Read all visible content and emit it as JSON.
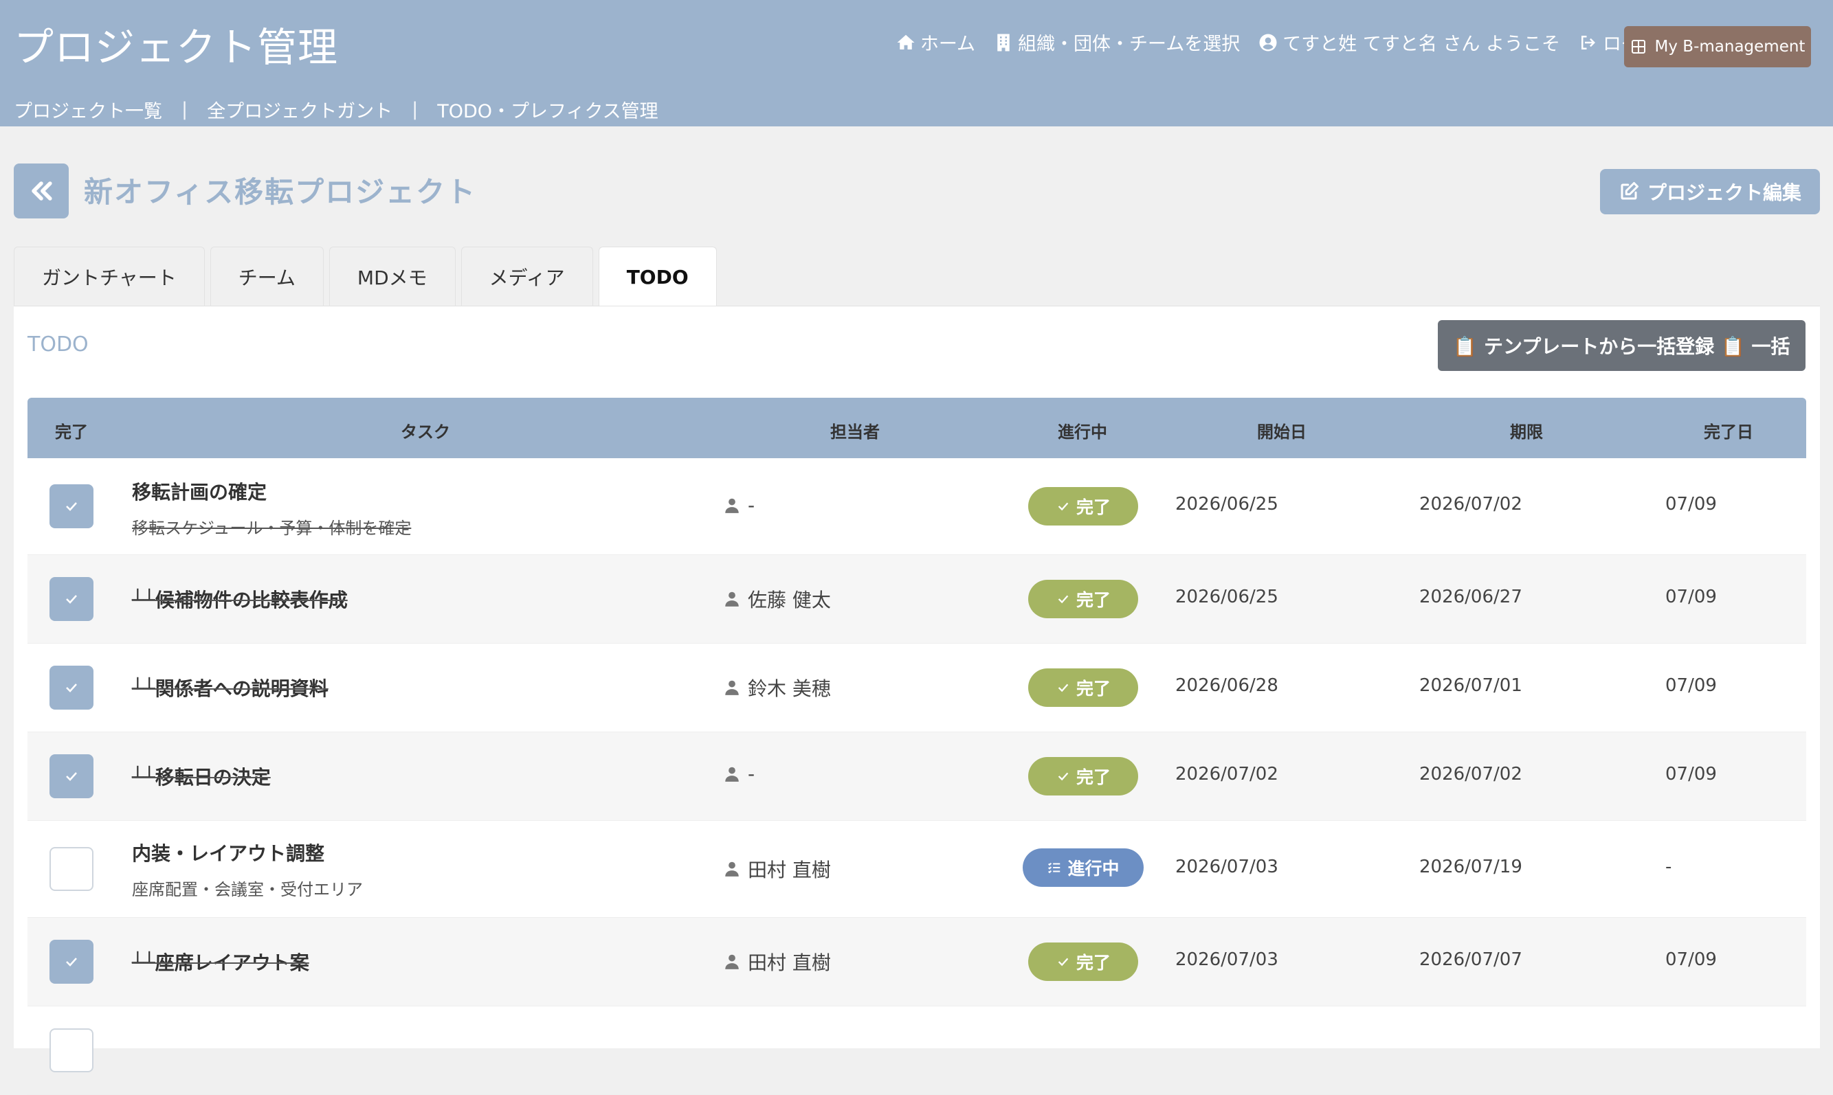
{
  "app_title": "プロジェクト管理",
  "topnav": {
    "home": "ホーム",
    "org_select": "組織・団体・チームを選択",
    "welcome": "てすと姓 てすと名 さん ようこそ",
    "logout": "ログアウト",
    "my_button": "My B-management"
  },
  "subnav": {
    "projects": "プロジェクト一覧",
    "gantt_all": "全プロジェクトガント",
    "todo_prefix": "TODO・プレフィクス管理",
    "separator": "|"
  },
  "project": {
    "title": "新オフィス移転プロジェクト",
    "edit_button": "プロジェクト編集"
  },
  "tabs": [
    "ガントチャート",
    "チーム",
    "MDメモ",
    "メディア",
    "TODO"
  ],
  "active_tab": "TODO",
  "panel": {
    "label": "TODO",
    "template_button": "📋 テンプレートから一括登録 📋 一括"
  },
  "table": {
    "headers": {
      "done": "完了",
      "task": "タスク",
      "assignee": "担当者",
      "status": "進行中",
      "start": "開始日",
      "due": "期限",
      "completed": "完了日"
    },
    "rows": [
      {
        "checked": true,
        "task": "移転計画の確定",
        "sub": "移転スケジュール・予算・体制を確定",
        "assignee": "-",
        "status": "完了",
        "start": "2026/06/25",
        "due": "2026/07/02",
        "completed": "07/09"
      },
      {
        "checked": true,
        "task": "┴┴候補物件の比較表作成",
        "sub": "",
        "assignee": "佐藤 健太",
        "status": "完了",
        "start": "2026/06/25",
        "due": "2026/06/27",
        "completed": "07/09"
      },
      {
        "checked": true,
        "task": "┴┴関係者への説明資料",
        "sub": "",
        "assignee": "鈴木 美穂",
        "status": "完了",
        "start": "2026/06/28",
        "due": "2026/07/01",
        "completed": "07/09"
      },
      {
        "checked": true,
        "task": "┴┴移転日の決定",
        "sub": "",
        "assignee": "-",
        "status": "完了",
        "start": "2026/07/02",
        "due": "2026/07/02",
        "completed": "07/09"
      },
      {
        "checked": false,
        "task": "内装・レイアウト調整",
        "sub": "座席配置・会議室・受付エリア",
        "assignee": "田村 直樹",
        "status": "進行中",
        "start": "2026/07/03",
        "due": "2026/07/19",
        "completed": "-"
      },
      {
        "checked": true,
        "task": "┴┴座席レイアウト案",
        "sub": "",
        "assignee": "田村 直樹",
        "status": "完了",
        "start": "2026/07/03",
        "due": "2026/07/07",
        "completed": "07/09"
      }
    ]
  },
  "colors": {
    "header_bg": "#9cb3cd",
    "my_button_bg": "#8d7266",
    "done_badge": "#a5b562",
    "progress_badge": "#6c8fc4",
    "template_button_bg": "#6b7179"
  }
}
